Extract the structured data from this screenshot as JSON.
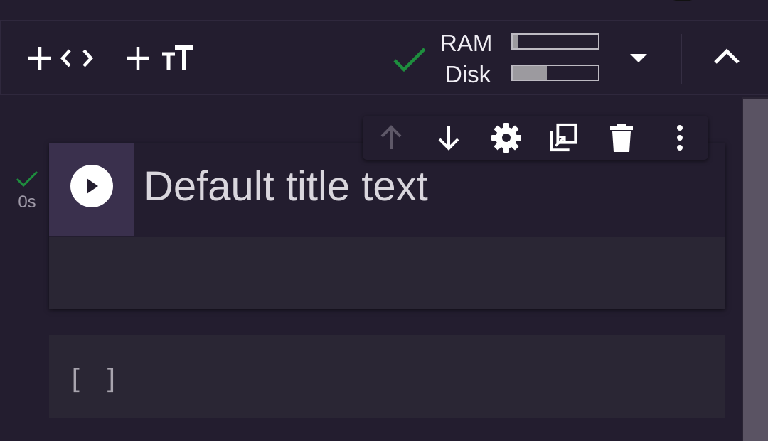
{
  "toolbar": {
    "add_code_label": "+ Code",
    "add_text_label": "+ Text",
    "resources": {
      "connected": true,
      "ram_label": "RAM",
      "disk_label": "Disk",
      "ram_usage_fraction": 0.06,
      "disk_usage_fraction": 0.4
    }
  },
  "cells": [
    {
      "type": "form",
      "title": "Default title text",
      "status": "completed",
      "exec_time": "0s",
      "toolbar": [
        "move-up",
        "move-down",
        "settings",
        "mirror-in-tab",
        "delete",
        "more"
      ]
    },
    {
      "type": "code",
      "execution_count": "[ ]"
    }
  ],
  "colors": {
    "background": "#231d2f",
    "success_green": "#1e8e3e",
    "run_area": "#3a304d",
    "cell_body": "#2a2634"
  }
}
